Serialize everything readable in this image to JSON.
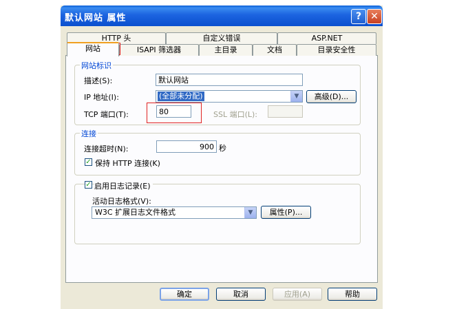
{
  "window": {
    "title": "默认网站 属性",
    "help_glyph": "?",
    "close_glyph": "✕"
  },
  "tabs_row1": [
    "HTTP 头",
    "自定义错误",
    "ASP.NET"
  ],
  "tabs_row2": [
    "网站",
    "ISAPI 筛选器",
    "主目录",
    "文档",
    "目录安全性"
  ],
  "website_id": {
    "legend": "网站标识",
    "desc_label": "描述(S):",
    "desc_value": "默认网站",
    "ip_label": "IP 地址(I):",
    "ip_value": "(全部未分配)",
    "advanced_button": "高级(D)...",
    "tcp_label": "TCP 端口(T):",
    "tcp_value": "80",
    "ssl_label": "SSL 端口(L):",
    "ssl_value": ""
  },
  "connection": {
    "legend": "连接",
    "timeout_label": "连接超时(N):",
    "timeout_value": "900",
    "timeout_unit": "秒",
    "keepalive_label": "保持 HTTP 连接(K)",
    "keepalive_checked": true
  },
  "logging": {
    "enable_label": "启用日志记录(E)",
    "enable_checked": true,
    "format_label": "活动日志格式(V):",
    "format_value": "W3C 扩展日志文件格式",
    "properties_button": "属性(P)..."
  },
  "footer": {
    "ok": "确定",
    "cancel": "取消",
    "apply": "应用(A)",
    "help": "帮助"
  }
}
